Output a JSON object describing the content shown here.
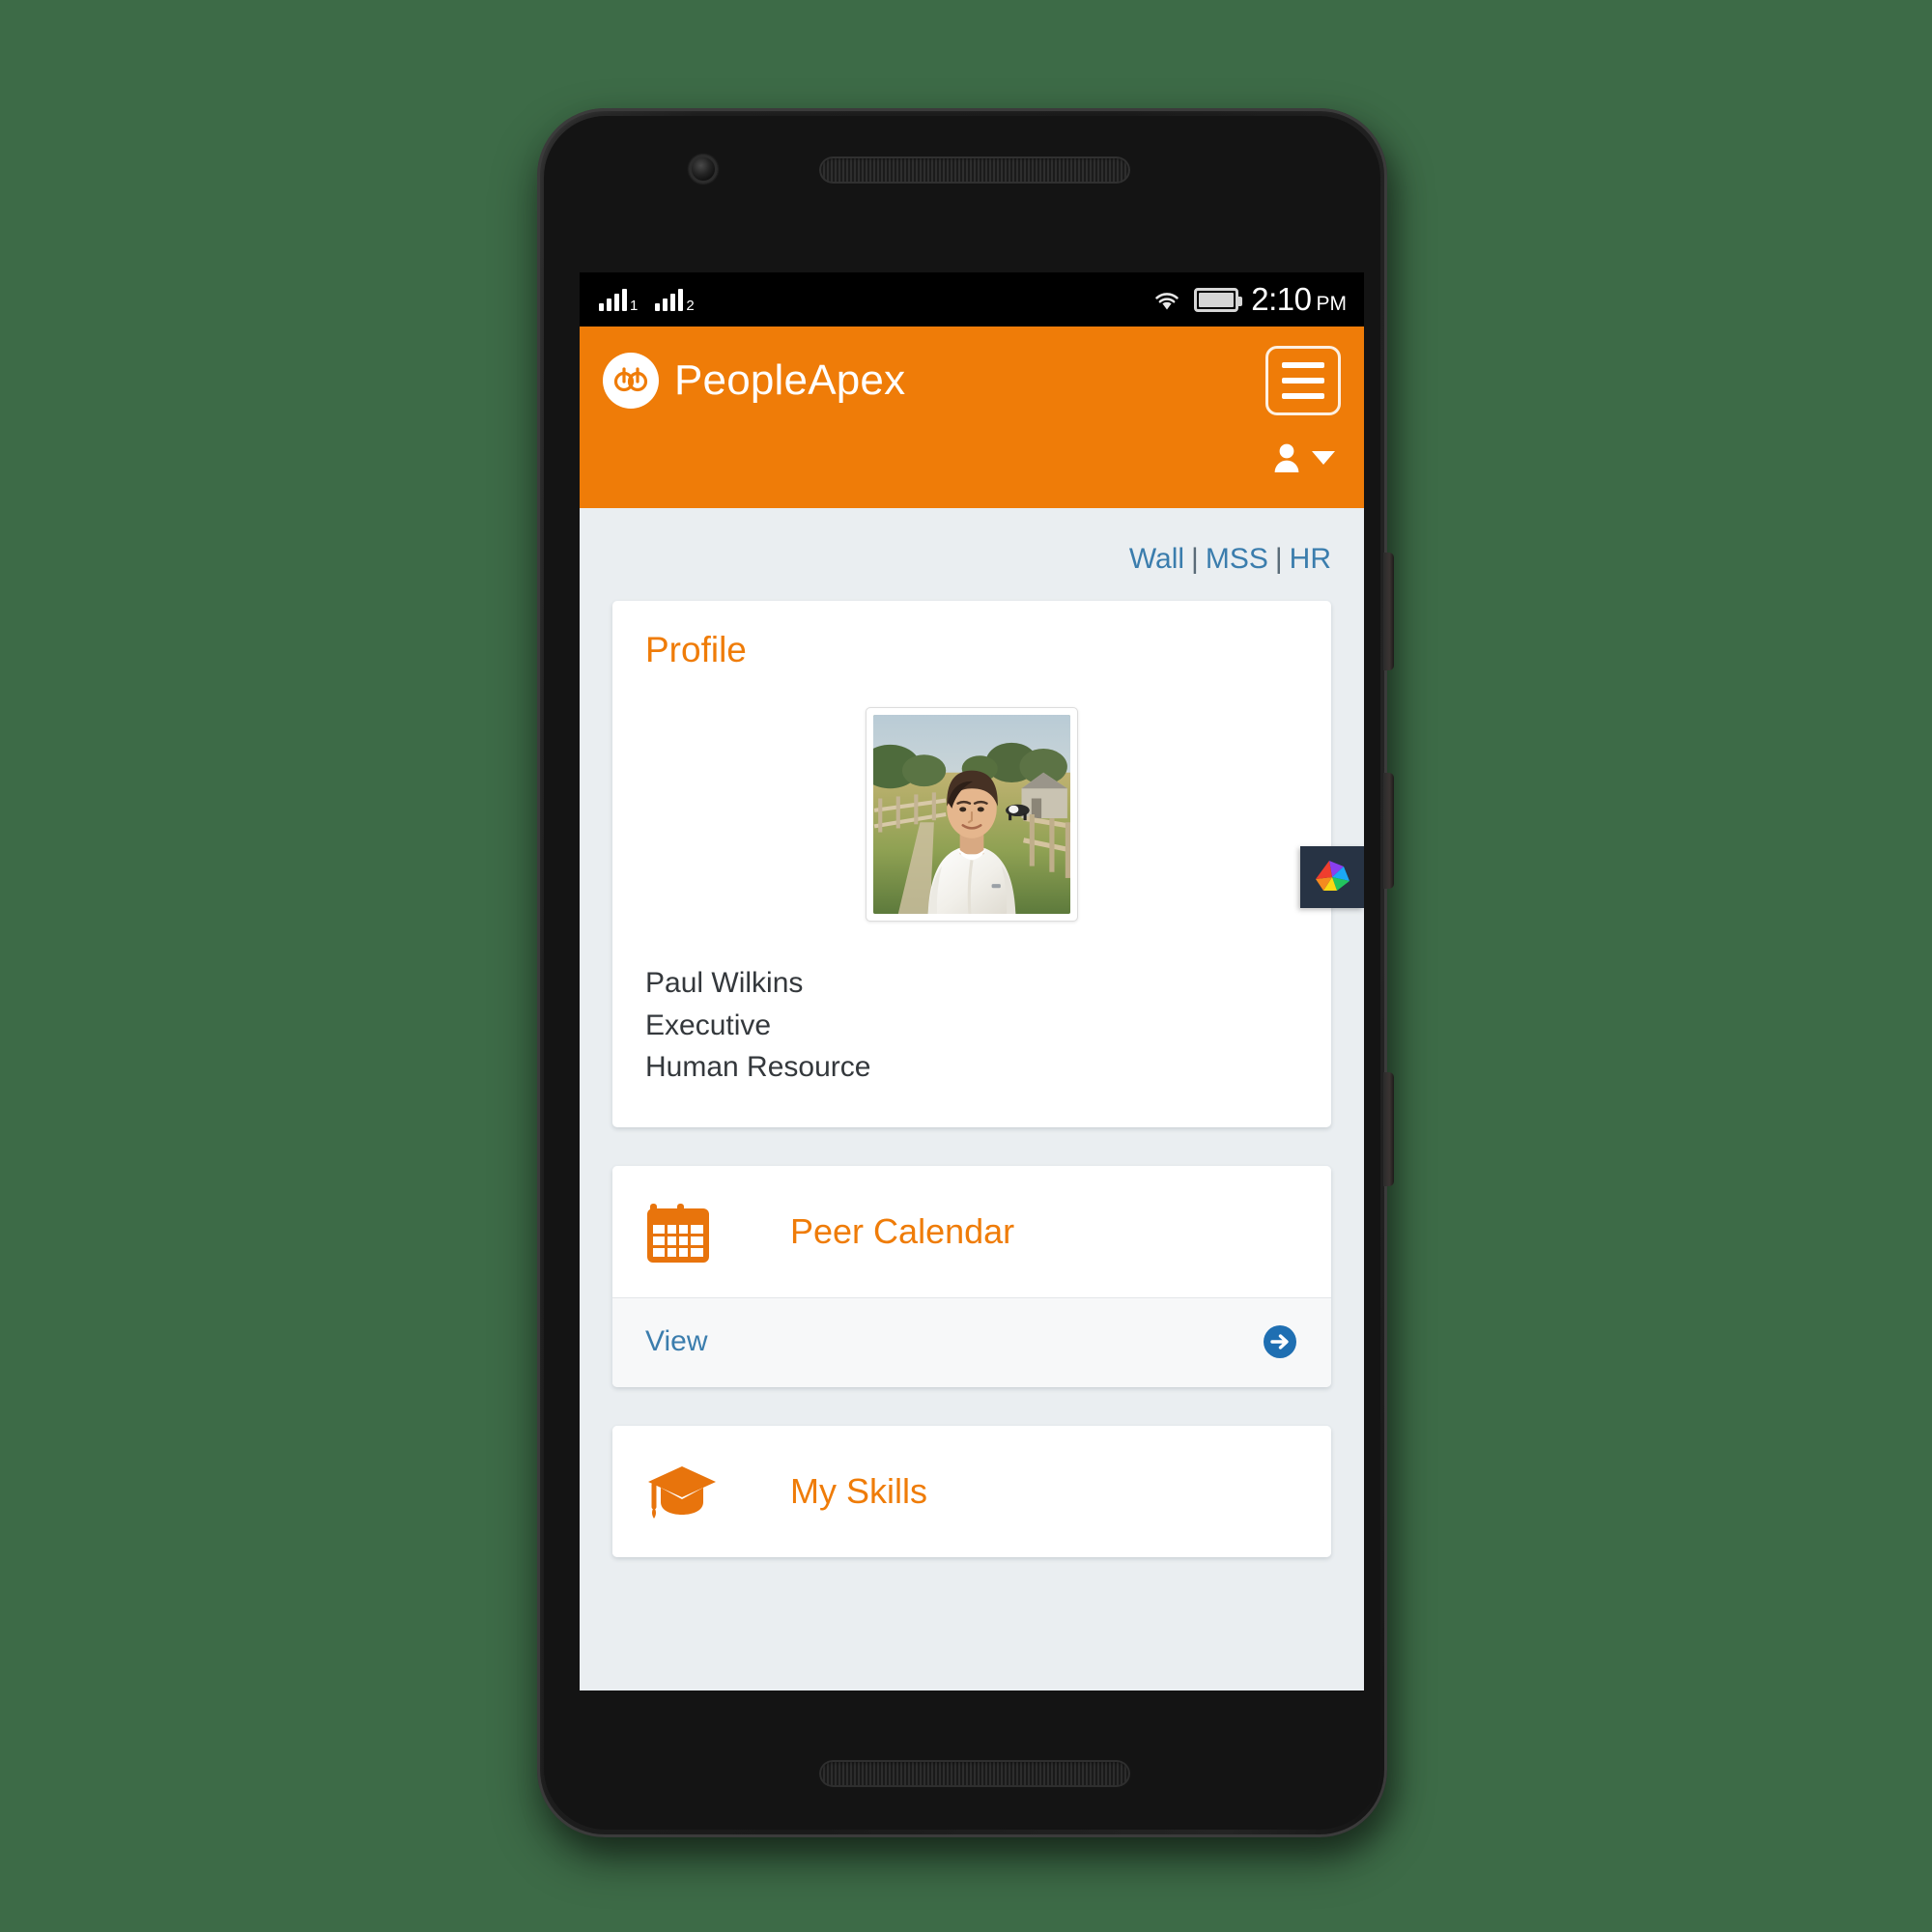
{
  "device": {
    "type": "android-phone",
    "front_camera": "front-camera",
    "earpiece": "earpiece-speaker",
    "bottom_speaker": "bottom-speaker"
  },
  "status_bar": {
    "sim1_label": "1",
    "sim2_label": "2",
    "wifi": "wifi-icon",
    "battery": "battery-icon",
    "time": "2:10",
    "ampm": "PM"
  },
  "header": {
    "brand_name": "PeopleApex",
    "logo_text": "pa",
    "menu_button": "menu",
    "user_menu": "user-account"
  },
  "quicknav": {
    "items": [
      {
        "label": "Wall"
      },
      {
        "label": "MSS"
      },
      {
        "label": "HR"
      }
    ],
    "separator": "|",
    "link_color": "#3b7dad"
  },
  "profile_card": {
    "title": "Profile",
    "photo_alt": "Paul Wilkins portrait",
    "name": "Paul Wilkins",
    "role": "Executive",
    "department": "Human Resource",
    "title_color": "#ef7c08"
  },
  "feature_cards": [
    {
      "icon": "calendar-icon",
      "label": "Peer Calendar",
      "action_label": "View",
      "has_footer": true
    },
    {
      "icon": "graduation-cap-icon",
      "label": "My Skills",
      "action_label": "",
      "has_footer": false
    }
  ],
  "side_tab": {
    "icon": "pinwheel-star-icon"
  },
  "theme": {
    "brand_orange": "#ef7c08",
    "link_blue": "#3b7dad",
    "page_bg": "#eaeef1",
    "card_bg": "#ffffff",
    "text_dark": "#34383c",
    "backdrop_green": "#3d6b47"
  }
}
